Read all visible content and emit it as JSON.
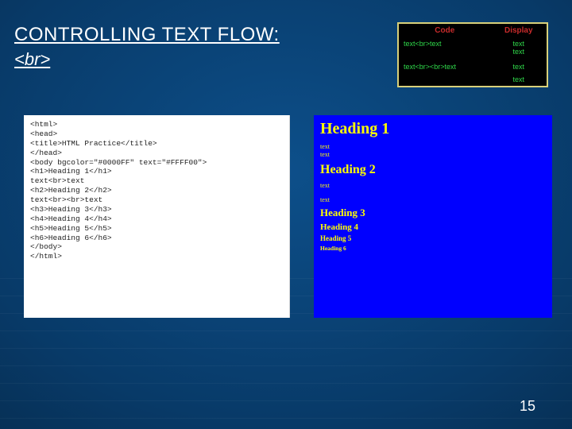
{
  "title": {
    "main": "CONTROLLING TEXT FLOW:",
    "sub": "<br>"
  },
  "mini": {
    "head_code": "Code",
    "head_disp": "Display",
    "r1_code": "text<br>text",
    "r1_d1": "text",
    "r1_d2": "text",
    "r2_code": "text<br><br>text",
    "r2_d1": "text",
    "r2_d2": "text"
  },
  "code": "<html>\n<head>\n<title>HTML Practice</title>\n</head>\n<body bgcolor=\"#0000FF\" text=\"#FFFF00\">\n<h1>Heading 1</h1>\ntext<br>text\n<h2>Heading 2</h2>\ntext<br><br>text\n<h3>Heading 3</h3>\n<h4>Heading 4</h4>\n<h5>Heading 5</h5>\n<h6>Heading 6</h6>\n</body>\n</html>",
  "render": {
    "h1": "Heading 1",
    "t1a": "text",
    "t1b": "text",
    "h2": "Heading 2",
    "t2a": "text",
    "t2b": "text",
    "h3": "Heading 3",
    "h4": "Heading 4",
    "h5": "Heading 5",
    "h6": "Heading 6"
  },
  "pagenum": "15",
  "chart_data": {
    "type": "table",
    "title": "br tag code vs display",
    "columns": [
      "Code",
      "Display"
    ],
    "rows": [
      [
        "text<br>text",
        "text\ntext"
      ],
      [
        "text<br><br>text",
        "text\n\ntext"
      ]
    ]
  }
}
